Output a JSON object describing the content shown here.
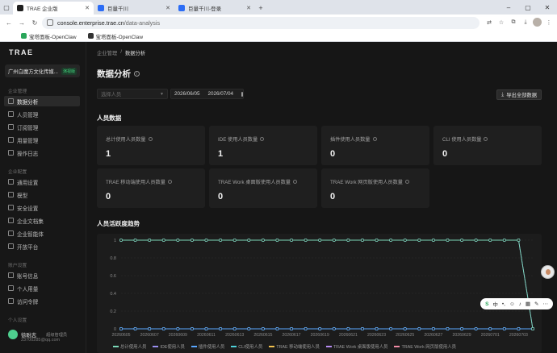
{
  "browser": {
    "tabs": [
      {
        "label": "TRAE 企业版",
        "active": true,
        "icon": "trae-favicon"
      },
      {
        "label": "巨量千川",
        "active": false,
        "icon": "qianchuan-favicon"
      },
      {
        "label": "巨量千川-登录",
        "active": false,
        "icon": "qianchuan-favicon"
      }
    ],
    "url_host": "console.enterprise.trae.cn",
    "url_path": "/data-analysis",
    "bookmarks": [
      {
        "label": "宝塔面板-OpenClaw"
      },
      {
        "label": "宝塔面板-OpenClaw"
      }
    ]
  },
  "sidebar": {
    "logo": "TRAE",
    "org_name": "广州白魔方文化传媒...",
    "org_badge": "演视版",
    "sections": [
      {
        "label": "企业管理",
        "items": [
          {
            "label": "数据分析",
            "active": true,
            "icon": "chart-icon"
          },
          {
            "label": "人员管理",
            "icon": "user-icon"
          },
          {
            "label": "订阅管理",
            "icon": "subscription-icon"
          },
          {
            "label": "用量管理",
            "icon": "usage-icon"
          },
          {
            "label": "操作日志",
            "icon": "log-icon"
          }
        ]
      },
      {
        "label": "企业配置",
        "items": [
          {
            "label": "通用设置",
            "icon": "settings-icon"
          },
          {
            "label": "模型",
            "icon": "model-icon"
          },
          {
            "label": "安全设置",
            "icon": "shield-icon"
          },
          {
            "label": "企业文档集",
            "icon": "docs-icon"
          },
          {
            "label": "企业智能体",
            "icon": "agent-icon"
          },
          {
            "label": "开放平台",
            "icon": "platform-icon"
          }
        ]
      },
      {
        "label": "账户设置",
        "items": [
          {
            "label": "账号信息",
            "icon": "account-icon"
          },
          {
            "label": "个人用量",
            "icon": "personal-usage-icon"
          },
          {
            "label": "访问令牌",
            "icon": "token-icon"
          }
        ]
      },
      {
        "label": "个人设置",
        "items": []
      }
    ],
    "user": {
      "name": "徐盼志",
      "role": "超级管理员",
      "email": "23700285@qq.com"
    }
  },
  "main": {
    "breadcrumb": [
      "企业管理",
      "数据分析"
    ],
    "title": "数据分析",
    "filter_placeholder": "选择人员",
    "date_start": "2026/06/05",
    "date_end": "2026/07/04",
    "export_label": "导出全部数据",
    "section_people": "人员数据",
    "cards": [
      {
        "label": "总计使用人员数量",
        "value": "1"
      },
      {
        "label": "IDE 使用人员数量",
        "value": "1"
      },
      {
        "label": "插件使用人员数量",
        "value": "0"
      },
      {
        "label": "CLI 使用人员数量",
        "value": "0"
      },
      {
        "label": "TRAE 移动端使用人员数量",
        "value": "0"
      },
      {
        "label": "TRAE Work 桌面版使用人员数量",
        "value": "0"
      },
      {
        "label": "TRAE Work 网页版使用人员数量",
        "value": "0"
      }
    ],
    "section_trend": "人员活跃度趋势"
  },
  "chart_data": {
    "type": "line",
    "ylim": [
      0,
      1
    ],
    "yticks": [
      "0",
      "0.2",
      "0.4",
      "0.6",
      "0.8",
      "1"
    ],
    "x": [
      "20260605",
      "20260606",
      "20260607",
      "20260608",
      "20260609",
      "20260610",
      "20260611",
      "20260612",
      "20260613",
      "20260614",
      "20260615",
      "20260616",
      "20260617",
      "20260618",
      "20260619",
      "20260620",
      "20260621",
      "20260622",
      "20260623",
      "20260624",
      "20260625",
      "20260626",
      "20260627",
      "20260628",
      "20260629",
      "20260630",
      "20260701",
      "20260702",
      "20260703",
      "20260704"
    ],
    "xtick_labels": [
      "20260605",
      "20260607",
      "20260609",
      "20260611",
      "20260613",
      "20260615",
      "20260617",
      "20260619",
      "20260621",
      "20260623",
      "20260625",
      "20260627",
      "20260629",
      "20260701",
      "20260703"
    ],
    "series": [
      {
        "name": "总计使用人员",
        "color": "#7bd9b8",
        "values": [
          1,
          1,
          1,
          1,
          1,
          1,
          1,
          1,
          1,
          1,
          1,
          1,
          1,
          1,
          1,
          1,
          1,
          1,
          1,
          1,
          1,
          1,
          1,
          1,
          1,
          1,
          1,
          1,
          1,
          0
        ]
      },
      {
        "name": "IDE使用人员",
        "color": "#9a8ff0",
        "values": [
          1,
          1,
          1,
          1,
          1,
          1,
          1,
          1,
          1,
          1,
          1,
          1,
          1,
          1,
          1,
          1,
          1,
          1,
          1,
          1,
          1,
          1,
          1,
          1,
          1,
          1,
          1,
          1,
          1,
          0
        ]
      },
      {
        "name": "插件使用人员",
        "color": "#5aa7ff",
        "values": [
          0,
          0,
          0,
          0,
          0,
          0,
          0,
          0,
          0,
          0,
          0,
          0,
          0,
          0,
          0,
          0,
          0,
          0,
          0,
          0,
          0,
          0,
          0,
          0,
          0,
          0,
          0,
          0,
          0,
          0
        ]
      },
      {
        "name": "CLI使用人员",
        "color": "#4fd1d9",
        "values": [
          0,
          0,
          0,
          0,
          0,
          0,
          0,
          0,
          0,
          0,
          0,
          0,
          0,
          0,
          0,
          0,
          0,
          0,
          0,
          0,
          0,
          0,
          0,
          0,
          0,
          0,
          0,
          0,
          0,
          0
        ]
      },
      {
        "name": "TRAE 移动端使用人员",
        "color": "#f2c14e",
        "values": [
          0,
          0,
          0,
          0,
          0,
          0,
          0,
          0,
          0,
          0,
          0,
          0,
          0,
          0,
          0,
          0,
          0,
          0,
          0,
          0,
          0,
          0,
          0,
          0,
          0,
          0,
          0,
          0,
          0,
          0
        ]
      },
      {
        "name": "TRAE Work 桌面版使用人员",
        "color": "#b78cf2",
        "values": [
          0,
          0,
          0,
          0,
          0,
          0,
          0,
          0,
          0,
          0,
          0,
          0,
          0,
          0,
          0,
          0,
          0,
          0,
          0,
          0,
          0,
          0,
          0,
          0,
          0,
          0,
          0,
          0,
          0,
          0
        ]
      },
      {
        "name": "TRAE Work 网页版使用人员",
        "color": "#f28ca6",
        "values": [
          0,
          0,
          0,
          0,
          0,
          0,
          0,
          0,
          0,
          0,
          0,
          0,
          0,
          0,
          0,
          0,
          0,
          0,
          0,
          0,
          0,
          0,
          0,
          0,
          0,
          0,
          0,
          0,
          0,
          0
        ]
      }
    ]
  },
  "ime": {
    "label": "中"
  }
}
